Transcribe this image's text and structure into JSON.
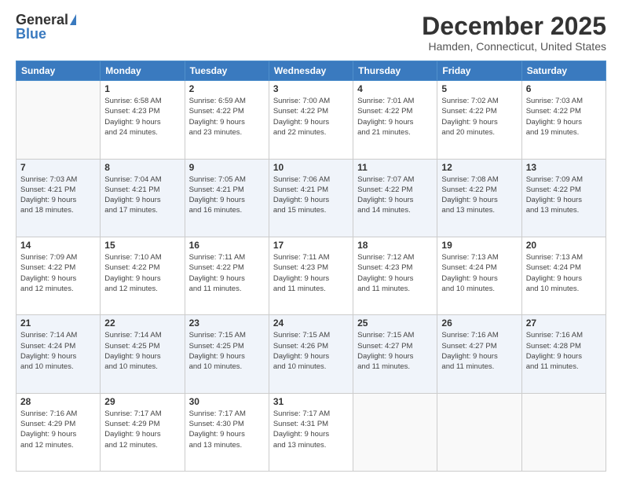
{
  "logo": {
    "general": "General",
    "blue": "Blue"
  },
  "title": "December 2025",
  "location": "Hamden, Connecticut, United States",
  "days_header": [
    "Sunday",
    "Monday",
    "Tuesday",
    "Wednesday",
    "Thursday",
    "Friday",
    "Saturday"
  ],
  "weeks": [
    [
      {
        "day": "",
        "info": ""
      },
      {
        "day": "1",
        "info": "Sunrise: 6:58 AM\nSunset: 4:23 PM\nDaylight: 9 hours\nand 24 minutes."
      },
      {
        "day": "2",
        "info": "Sunrise: 6:59 AM\nSunset: 4:22 PM\nDaylight: 9 hours\nand 23 minutes."
      },
      {
        "day": "3",
        "info": "Sunrise: 7:00 AM\nSunset: 4:22 PM\nDaylight: 9 hours\nand 22 minutes."
      },
      {
        "day": "4",
        "info": "Sunrise: 7:01 AM\nSunset: 4:22 PM\nDaylight: 9 hours\nand 21 minutes."
      },
      {
        "day": "5",
        "info": "Sunrise: 7:02 AM\nSunset: 4:22 PM\nDaylight: 9 hours\nand 20 minutes."
      },
      {
        "day": "6",
        "info": "Sunrise: 7:03 AM\nSunset: 4:22 PM\nDaylight: 9 hours\nand 19 minutes."
      }
    ],
    [
      {
        "day": "7",
        "info": "Sunrise: 7:03 AM\nSunset: 4:21 PM\nDaylight: 9 hours\nand 18 minutes."
      },
      {
        "day": "8",
        "info": "Sunrise: 7:04 AM\nSunset: 4:21 PM\nDaylight: 9 hours\nand 17 minutes."
      },
      {
        "day": "9",
        "info": "Sunrise: 7:05 AM\nSunset: 4:21 PM\nDaylight: 9 hours\nand 16 minutes."
      },
      {
        "day": "10",
        "info": "Sunrise: 7:06 AM\nSunset: 4:21 PM\nDaylight: 9 hours\nand 15 minutes."
      },
      {
        "day": "11",
        "info": "Sunrise: 7:07 AM\nSunset: 4:22 PM\nDaylight: 9 hours\nand 14 minutes."
      },
      {
        "day": "12",
        "info": "Sunrise: 7:08 AM\nSunset: 4:22 PM\nDaylight: 9 hours\nand 13 minutes."
      },
      {
        "day": "13",
        "info": "Sunrise: 7:09 AM\nSunset: 4:22 PM\nDaylight: 9 hours\nand 13 minutes."
      }
    ],
    [
      {
        "day": "14",
        "info": "Sunrise: 7:09 AM\nSunset: 4:22 PM\nDaylight: 9 hours\nand 12 minutes."
      },
      {
        "day": "15",
        "info": "Sunrise: 7:10 AM\nSunset: 4:22 PM\nDaylight: 9 hours\nand 12 minutes."
      },
      {
        "day": "16",
        "info": "Sunrise: 7:11 AM\nSunset: 4:22 PM\nDaylight: 9 hours\nand 11 minutes."
      },
      {
        "day": "17",
        "info": "Sunrise: 7:11 AM\nSunset: 4:23 PM\nDaylight: 9 hours\nand 11 minutes."
      },
      {
        "day": "18",
        "info": "Sunrise: 7:12 AM\nSunset: 4:23 PM\nDaylight: 9 hours\nand 11 minutes."
      },
      {
        "day": "19",
        "info": "Sunrise: 7:13 AM\nSunset: 4:24 PM\nDaylight: 9 hours\nand 10 minutes."
      },
      {
        "day": "20",
        "info": "Sunrise: 7:13 AM\nSunset: 4:24 PM\nDaylight: 9 hours\nand 10 minutes."
      }
    ],
    [
      {
        "day": "21",
        "info": "Sunrise: 7:14 AM\nSunset: 4:24 PM\nDaylight: 9 hours\nand 10 minutes."
      },
      {
        "day": "22",
        "info": "Sunrise: 7:14 AM\nSunset: 4:25 PM\nDaylight: 9 hours\nand 10 minutes."
      },
      {
        "day": "23",
        "info": "Sunrise: 7:15 AM\nSunset: 4:25 PM\nDaylight: 9 hours\nand 10 minutes."
      },
      {
        "day": "24",
        "info": "Sunrise: 7:15 AM\nSunset: 4:26 PM\nDaylight: 9 hours\nand 10 minutes."
      },
      {
        "day": "25",
        "info": "Sunrise: 7:15 AM\nSunset: 4:27 PM\nDaylight: 9 hours\nand 11 minutes."
      },
      {
        "day": "26",
        "info": "Sunrise: 7:16 AM\nSunset: 4:27 PM\nDaylight: 9 hours\nand 11 minutes."
      },
      {
        "day": "27",
        "info": "Sunrise: 7:16 AM\nSunset: 4:28 PM\nDaylight: 9 hours\nand 11 minutes."
      }
    ],
    [
      {
        "day": "28",
        "info": "Sunrise: 7:16 AM\nSunset: 4:29 PM\nDaylight: 9 hours\nand 12 minutes."
      },
      {
        "day": "29",
        "info": "Sunrise: 7:17 AM\nSunset: 4:29 PM\nDaylight: 9 hours\nand 12 minutes."
      },
      {
        "day": "30",
        "info": "Sunrise: 7:17 AM\nSunset: 4:30 PM\nDaylight: 9 hours\nand 13 minutes."
      },
      {
        "day": "31",
        "info": "Sunrise: 7:17 AM\nSunset: 4:31 PM\nDaylight: 9 hours\nand 13 minutes."
      },
      {
        "day": "",
        "info": ""
      },
      {
        "day": "",
        "info": ""
      },
      {
        "day": "",
        "info": ""
      }
    ]
  ]
}
